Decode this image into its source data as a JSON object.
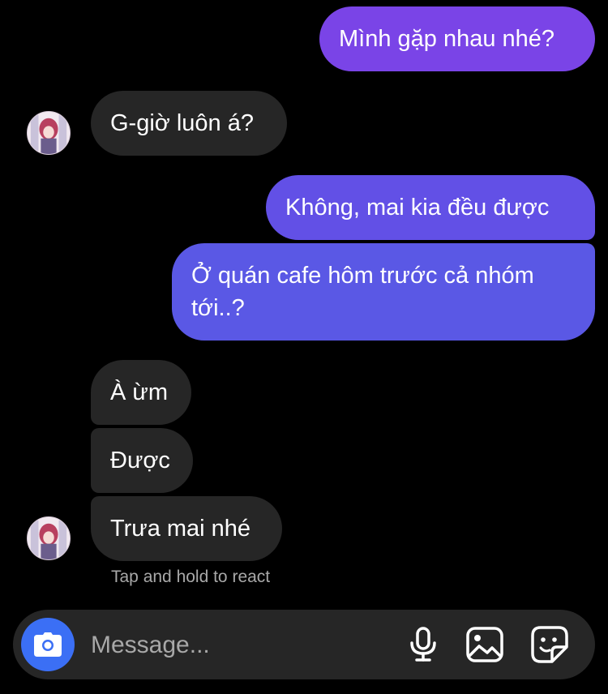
{
  "messages": [
    {
      "id": "m1",
      "direction": "outgoing",
      "text": "Mình gặp nhau nhé?"
    },
    {
      "id": "m2",
      "direction": "incoming",
      "text": "G-giờ luôn á?"
    },
    {
      "id": "m3",
      "direction": "outgoing",
      "text": "Không, mai kia đều được"
    },
    {
      "id": "m4",
      "direction": "outgoing",
      "text": "Ở quán cafe hôm trước cả nhóm tới..?"
    },
    {
      "id": "m5",
      "direction": "incoming",
      "text": "À ừm"
    },
    {
      "id": "m6",
      "direction": "incoming",
      "text": "Được"
    },
    {
      "id": "m7",
      "direction": "incoming",
      "text": "Trưa mai nhé"
    }
  ],
  "hint": "Tap and hold to react",
  "composer": {
    "placeholder": "Message...",
    "value": "",
    "icons": [
      "camera-icon",
      "microphone-icon",
      "gallery-icon",
      "sticker-icon"
    ]
  },
  "colors": {
    "background": "#000000",
    "incoming_bubble": "#262626",
    "outgoing_gradient_top": "#7c45e8",
    "outgoing_gradient_bottom": "#5a5be5",
    "camera_button": "#3b6ff5",
    "hint_text": "#a8a8a8"
  }
}
